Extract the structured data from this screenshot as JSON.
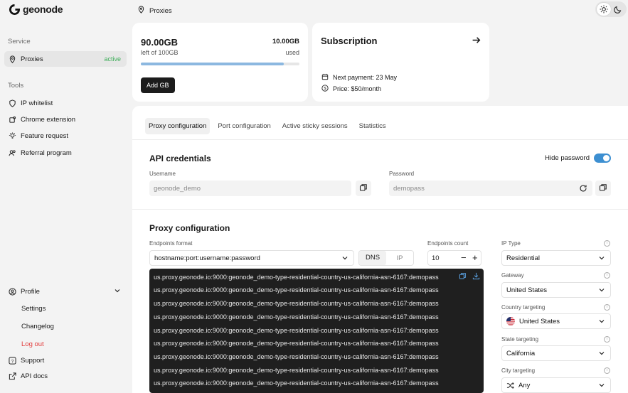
{
  "app": {
    "logo_text": "geonode",
    "breadcrumb": "Proxies"
  },
  "sidebar": {
    "service_label": "Service",
    "proxies": {
      "label": "Proxies",
      "badge": "active"
    },
    "tools_label": "Tools",
    "tools": [
      {
        "label": "IP whitelist",
        "icon": "shield-icon"
      },
      {
        "label": "Chrome extension",
        "icon": "extension-icon"
      },
      {
        "label": "Feature request",
        "icon": "lightbulb-icon"
      },
      {
        "label": "Referral program",
        "icon": "users-icon"
      }
    ],
    "profile": {
      "label": "Profile",
      "items": [
        "Settings",
        "Changelog",
        "Log out"
      ]
    },
    "support": "Support",
    "api_docs": "API docs"
  },
  "usage": {
    "remaining": "90.00GB",
    "remaining_sub": "left of 100GB",
    "used": "10.00GB",
    "used_sub": "used",
    "progress": 0.9,
    "add_button": "Add GB"
  },
  "subscription": {
    "title": "Subscription",
    "next_payment": "Next payment: 23 May",
    "price": "Price: $50/month"
  },
  "tabs": [
    "Proxy configuration",
    "Port configuration",
    "Active sticky sessions",
    "Statistics"
  ],
  "credentials": {
    "title": "API credentials",
    "hide_password_label": "Hide password",
    "hide_password": true,
    "username_label": "Username",
    "username": "geonode_demo",
    "password_label": "Password",
    "password": "demopass"
  },
  "proxy_config": {
    "title": "Proxy configuration",
    "endpoints_format_label": "Endpoints format",
    "endpoints_format": "hostname:port:username:password",
    "dns_label": "DNS",
    "ip_label": "IP",
    "endpoints_count_label": "Endpoints count",
    "endpoints_count": "10",
    "lines": [
      "us.proxy.geonode.io:9000:geonode_demo-type-residential-country-us-california-asn-6167:demopass",
      "us.proxy.geonode.io:9000:geonode_demo-type-residential-country-us-california-asn-6167:demopass",
      "us.proxy.geonode.io:9000:geonode_demo-type-residential-country-us-california-asn-6167:demopass",
      "us.proxy.geonode.io:9000:geonode_demo-type-residential-country-us-california-asn-6167:demopass",
      "us.proxy.geonode.io:9000:geonode_demo-type-residential-country-us-california-asn-6167:demopass",
      "us.proxy.geonode.io:9000:geonode_demo-type-residential-country-us-california-asn-6167:demopass",
      "us.proxy.geonode.io:9000:geonode_demo-type-residential-country-us-california-asn-6167:demopass",
      "us.proxy.geonode.io:9000:geonode_demo-type-residential-country-us-california-asn-6167:demopass",
      "us.proxy.geonode.io:9000:geonode_demo-type-residential-country-us-california-asn-6167:demopass"
    ]
  },
  "right_panel": {
    "ip_type_label": "IP Type",
    "ip_type": "Residential",
    "gateway_label": "Gateway",
    "gateway": "United States",
    "country_label": "Country targeting",
    "country": "United States",
    "state_label": "State targeting",
    "state": "California",
    "city_label": "City targeting",
    "city": "Any"
  },
  "colors": {
    "accent": "#3d8fd1",
    "active_badge": "#3fae5a",
    "logout": "#e23b3b",
    "progress": "#8cb8e0"
  }
}
